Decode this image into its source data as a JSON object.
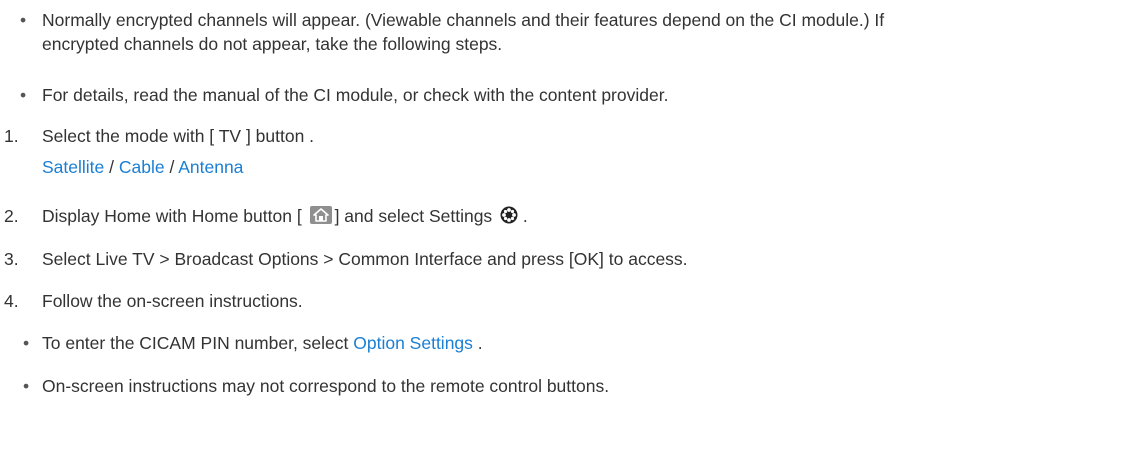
{
  "bullets_top": [
    {
      "mark": "•",
      "line1": "Normally encrypted channels will appear. (Viewable channels and their features depend on the CI module.) If",
      "line2": "encrypted channels do not appear, take the following steps."
    },
    {
      "mark": "•",
      "line1": "For details, read the manual of the CI module, or check with the content provider."
    }
  ],
  "steps": [
    {
      "num": "1.",
      "text": "Select the mode with [ TV ] button .",
      "modes": [
        "Satellite",
        "Cable",
        "Antenna"
      ],
      "separator": " / "
    },
    {
      "num": "2.",
      "text_before": "Display Home with Home button [",
      "text_mid": "] and select Settings",
      "text_after": " ."
    },
    {
      "num": "3.",
      "text": "Select Live TV > Broadcast Options > Common Interface and press [OK] to access."
    },
    {
      "num": "4.",
      "text": "Follow the on-screen instructions."
    }
  ],
  "bullets_bottom": [
    {
      "mark": "•",
      "text_before": "To enter the CICAM PIN number, select ",
      "link": "Option Settings",
      "text_after": " ."
    },
    {
      "mark": "•",
      "text": "On-screen instructions may not correspond to the remote control buttons."
    }
  ],
  "icons": {
    "home": "home-icon",
    "settings": "gear-icon"
  },
  "colors": {
    "text": "#333333",
    "link": "#1a7fd4",
    "icon_bg": "#8f8f8f"
  }
}
